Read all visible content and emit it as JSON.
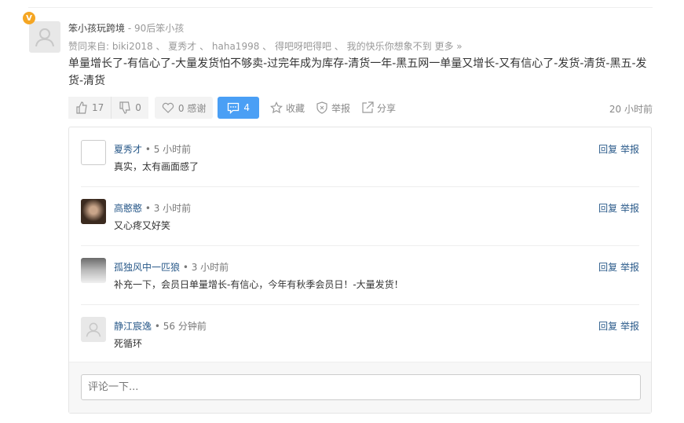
{
  "post": {
    "author": "笨小孩玩跨境",
    "separator": " - ",
    "signature": "90后笨小孩",
    "badge": "V",
    "voters_label": "赞同来自: ",
    "voters": "biki2018 、 夏秀才 、 haha1998 、 得吧呀吧得吧 、 我的快乐你想象不到",
    "more": "更多 »",
    "content": "单量增长了-有信心了-大量发货怕不够卖-过完年成为库存-清货一年-黑五网一单量又增长-又有信心了-发货-清货-黑五-发货-清货",
    "time": "20 小时前"
  },
  "actions": {
    "upvotes": "17",
    "downvotes": "0",
    "thanks": "0 感谢",
    "comments": "4",
    "favorite": "收藏",
    "report": "举报",
    "share": "分享"
  },
  "comments": [
    {
      "name": "夏秀才",
      "time": "5 小时前",
      "text": "真实，太有画面感了",
      "reply": "回复",
      "report": "举报"
    },
    {
      "name": "高憨憨",
      "time": "3 小时前",
      "text": "又心疼又好笑",
      "reply": "回复",
      "report": "举报"
    },
    {
      "name": "孤独风中一匹狼",
      "time": "3 小时前",
      "text": "补充一下，会员日单量增长-有信心，今年有秋季会员日！-大量发货！",
      "reply": "回复",
      "report": "举报"
    },
    {
      "name": "静江宸逸",
      "time": "56 分钟前",
      "text": "死循环",
      "reply": "回复",
      "report": "举报"
    }
  ],
  "comment_input": {
    "placeholder": "评论一下..."
  }
}
